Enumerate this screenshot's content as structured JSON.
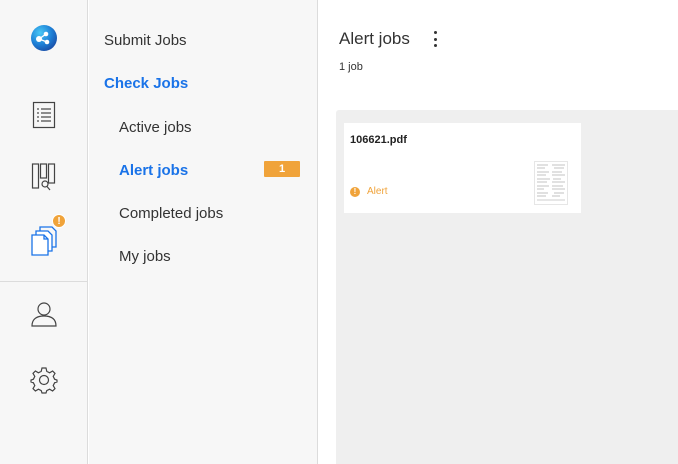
{
  "rail": {
    "items": [
      {
        "name": "app-logo-icon"
      },
      {
        "name": "list-icon"
      },
      {
        "name": "board-search-icon"
      },
      {
        "name": "documents-icon",
        "badge": "!"
      },
      {
        "name": "user-icon"
      },
      {
        "name": "gear-icon"
      }
    ],
    "accent": "#1a73e8",
    "badge_color": "#f0a33a"
  },
  "menu": {
    "submit_jobs": "Submit Jobs",
    "check_jobs": "Check Jobs",
    "active_jobs": "Active jobs",
    "alert_jobs": "Alert jobs",
    "alert_count": "1",
    "completed_jobs": "Completed jobs",
    "my_jobs": "My jobs"
  },
  "main": {
    "title": "Alert jobs",
    "job_count": "1 job",
    "cards": [
      {
        "file_name": "106621.pdf",
        "status_icon": "!",
        "status": "Alert",
        "thumbnail": "document-thumbnail"
      }
    ]
  }
}
